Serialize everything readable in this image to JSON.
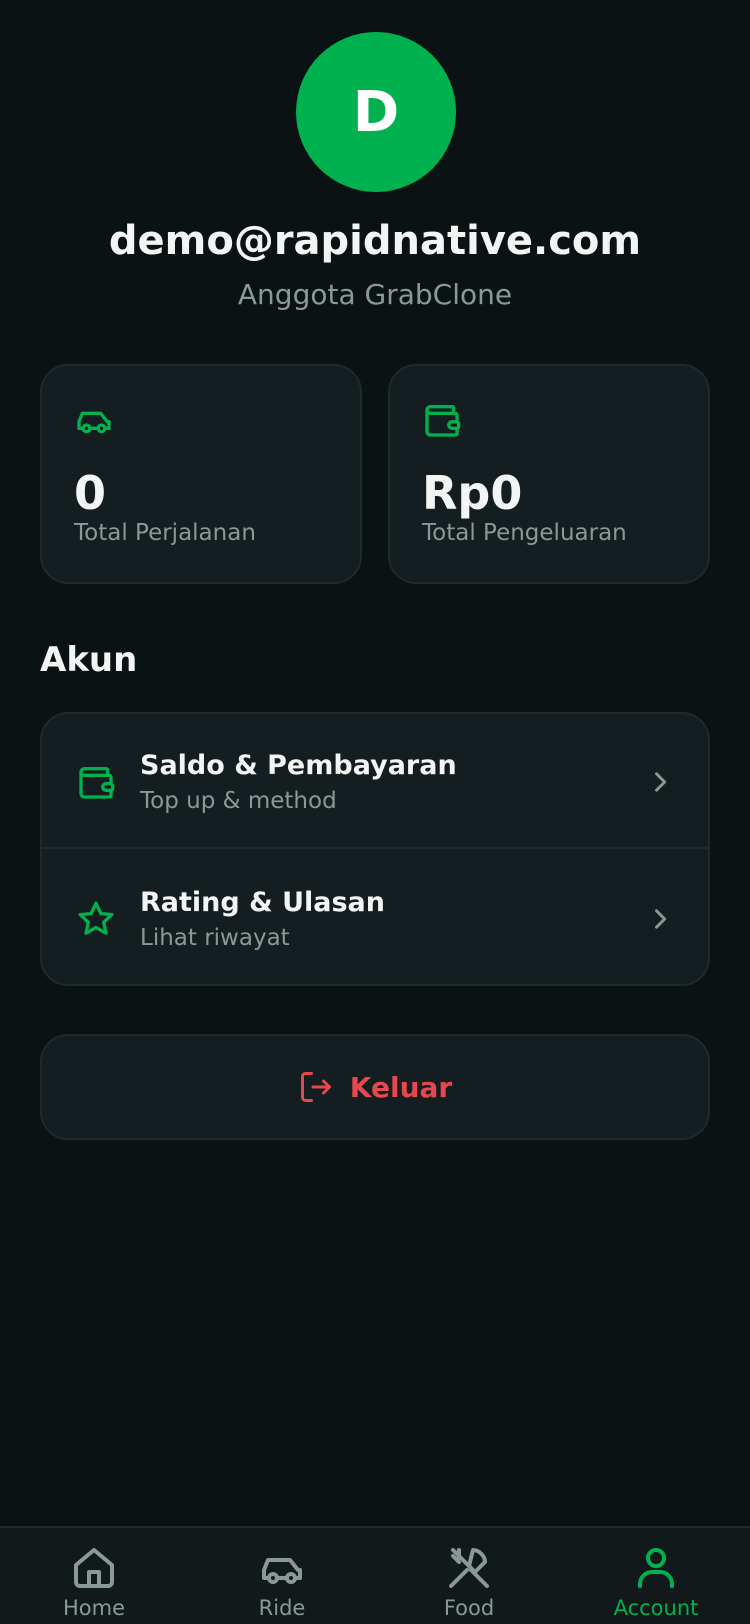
{
  "profile": {
    "avatar_initial": "D",
    "email": "demo@rapidnative.com",
    "membership": "Anggota GrabClone"
  },
  "stats": [
    {
      "icon": "car-icon",
      "value": "0",
      "label": "Total Perjalanan"
    },
    {
      "icon": "wallet-icon",
      "value": "Rp0",
      "label": "Total Pengeluaran"
    }
  ],
  "account_section": {
    "title": "Akun",
    "items": [
      {
        "icon": "wallet-icon",
        "title": "Saldo & Pembayaran",
        "subtitle": "Top up & method"
      },
      {
        "icon": "star-icon",
        "title": "Rating & Ulasan",
        "subtitle": "Lihat riwayat"
      }
    ]
  },
  "logout": {
    "label": "Keluar"
  },
  "bottom_nav": [
    {
      "icon": "home-icon",
      "label": "Home",
      "active": false
    },
    {
      "icon": "car-icon",
      "label": "Ride",
      "active": false
    },
    {
      "icon": "utensils-icon",
      "label": "Food",
      "active": false
    },
    {
      "icon": "user-icon",
      "label": "Account",
      "active": true
    }
  ],
  "colors": {
    "accent": "#00b14f",
    "background": "#0b1214",
    "card": "#141d1f",
    "danger": "#e5484d",
    "muted": "#8a9996"
  }
}
